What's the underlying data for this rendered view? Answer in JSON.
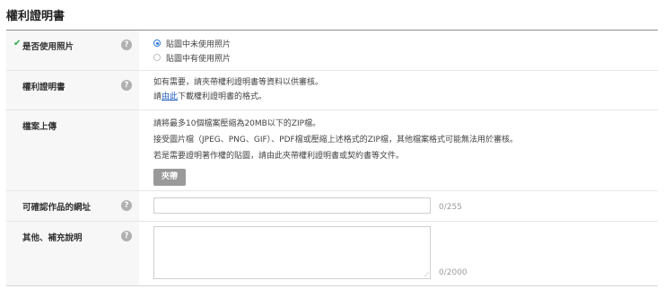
{
  "page_title": "權利證明書",
  "rows": {
    "usage": {
      "label": "是否使用照片",
      "help": "?",
      "options": [
        {
          "label": "貼圖中未使用照片",
          "checked": true
        },
        {
          "label": "貼圖中有使用照片",
          "checked": false
        }
      ]
    },
    "certificate": {
      "label": "權利證明書",
      "help": "?",
      "line1": "如有需要，請夾帶權利證明書等資料以供審核。",
      "line2_prefix": "請",
      "line2_link": "由此",
      "line2_suffix": "下載權利證明書的格式。"
    },
    "upload": {
      "label": "檔案上傳",
      "line1": "請將最多10個檔案壓縮為20MB以下的ZIP檔。",
      "line2": "接受圖片檔（JPEG、PNG、GIF）、PDF檔或壓縮上述格式的ZIP檔，其他檔案格式可能無法用於審核。",
      "line3": "若是需要證明著作權的貼圖，請由此夾帶權利證明書或契約書等文件。",
      "button": "夾帶"
    },
    "url": {
      "label": "可確認作品的網址",
      "help": "?",
      "value": "",
      "counter": "0/255"
    },
    "notes": {
      "label": "其他、補充說明",
      "help": "?",
      "value": "",
      "counter": "0/2000"
    }
  },
  "colors": {
    "accent_blue": "#2f7bd7",
    "check_green": "#2faa4a",
    "label_bg": "#f7f7f7",
    "button_gray": "#9a9a9a"
  }
}
